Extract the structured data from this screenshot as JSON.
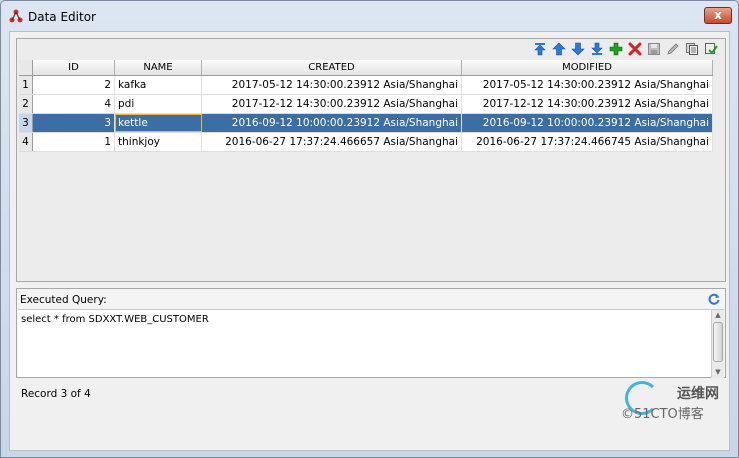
{
  "window": {
    "title": "Data Editor",
    "close_label": "x"
  },
  "toolbar": {
    "buttons": [
      "move-first-icon",
      "move-up-icon",
      "move-down-icon",
      "move-last-icon",
      "add-row-icon",
      "delete-row-icon",
      "save-icon",
      "edit-icon",
      "copy-icon",
      "commit-icon"
    ]
  },
  "table": {
    "columns": [
      "",
      "ID",
      "NAME",
      "CREATED",
      "MODIFIED"
    ],
    "rows": [
      {
        "num": "1",
        "id": "2",
        "name": "kafka",
        "created": "2017-05-12 14:30:00.23912 Asia/Shanghai",
        "modified": "2017-05-12 14:30:00.23912 Asia/Shanghai"
      },
      {
        "num": "2",
        "id": "4",
        "name": "pdi",
        "created": "2017-12-12 14:30:00.23912 Asia/Shanghai",
        "modified": "2017-12-12 14:30:00.23912 Asia/Shanghai"
      },
      {
        "num": "3",
        "id": "3",
        "name": "kettle",
        "created": "2016-09-12 10:00:00.23912 Asia/Shanghai",
        "modified": "2016-09-12 10:00:00.23912 Asia/Shanghai"
      },
      {
        "num": "4",
        "id": "1",
        "name": "thinkjoy",
        "created": "2016-06-27 17:37:24.466657 Asia/Shanghai",
        "modified": "2016-06-27 17:37:24.466745 Asia/Shanghai"
      }
    ],
    "selected_row": 2
  },
  "query": {
    "label": "Executed Query:",
    "text": "select * from SDXXT.WEB_CUSTOMER"
  },
  "status": {
    "text": "Record 3 of 4"
  },
  "watermark": {
    "line1": "运维网",
    "line2": "©51CTO博客"
  },
  "colors": {
    "selection": "#3a6ea5",
    "accent_blue": "#2a7ad8",
    "add_green": "#1ea11e",
    "delete_red": "#d42020"
  }
}
